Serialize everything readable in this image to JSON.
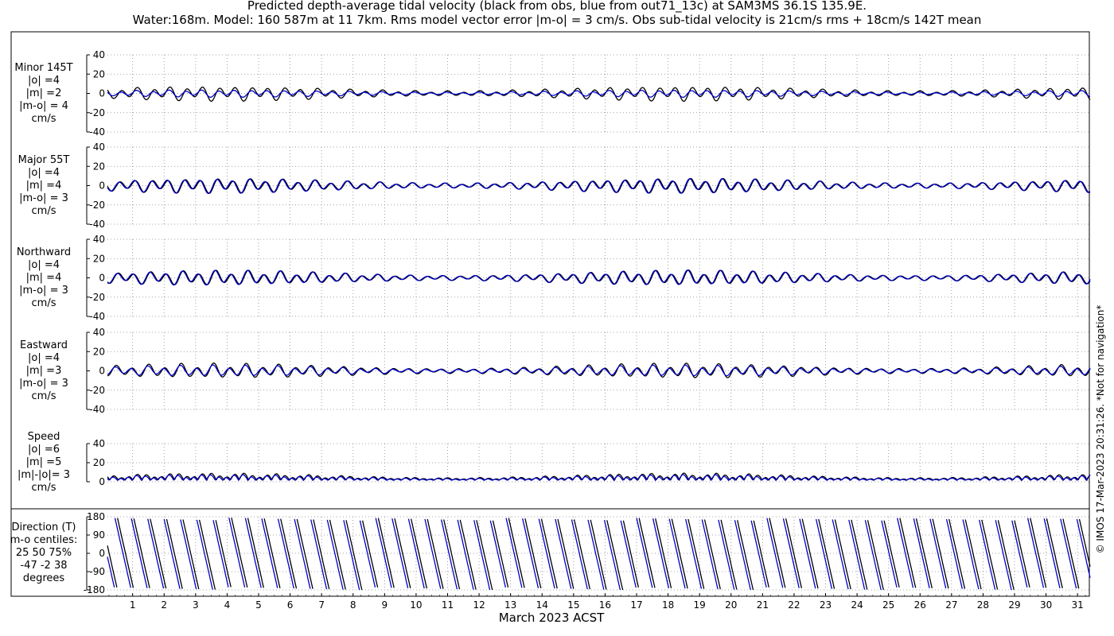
{
  "chart_data": {
    "type": "line",
    "title": "Predicted depth-average tidal velocity (black from obs, blue from out71_13c) at SAM3MS 36.1S 135.9E.",
    "subtitle": "Water:168m. Model: 160 587m at 11 7km. Rms model vector error |m-o| = 3 cm/s. Obs sub-tidal velocity is 21cm/s rms + 18cm/s 142T mean",
    "xlabel": "March 2023 ACST",
    "x_ticks": [
      "1",
      "2",
      "3",
      "4",
      "5",
      "6",
      "7",
      "8",
      "9",
      "10",
      "11",
      "12",
      "13",
      "14",
      "15",
      "16",
      "17",
      "18",
      "19",
      "20",
      "21",
      "22",
      "23",
      "24",
      "25",
      "26",
      "27",
      "28",
      "29",
      "30",
      "31"
    ],
    "xlim": [
      0.2,
      31.4
    ],
    "grid": true,
    "side_note": "© IMOS 17-Mar-2023 20:31:26. *Not for navigation*",
    "series_colors": {
      "obs": "#000000",
      "model": "#0000cc"
    },
    "panels": [
      {
        "id": "minor",
        "label": [
          "Minor 145T",
          "|o| =4",
          "|m| =2",
          "|m-o| = 4",
          "cm/s"
        ],
        "ylim": [
          -40,
          40
        ],
        "yticks": [
          "40",
          "20",
          "0",
          "-20",
          "-40"
        ],
        "amp_obs": 4,
        "amp_model": 2,
        "offset": 0
      },
      {
        "id": "major",
        "label": [
          "Major 55T",
          "|o| =4",
          "|m| =4",
          "|m-o| = 3",
          "cm/s"
        ],
        "ylim": [
          -40,
          40
        ],
        "yticks": [
          "40",
          "20",
          "0",
          "-20",
          "-40"
        ],
        "amp_obs": 4,
        "amp_model": 4,
        "offset": 0
      },
      {
        "id": "north",
        "label": [
          "Northward",
          "|o| =4",
          "|m| =4",
          "|m-o| = 3",
          "cm/s"
        ],
        "ylim": [
          -40,
          40
        ],
        "yticks": [
          "40",
          "20",
          "0",
          "-20",
          "-40"
        ],
        "amp_obs": 4,
        "amp_model": 4,
        "offset": 0
      },
      {
        "id": "east",
        "label": [
          "Eastward",
          "|o| =4",
          "|m| =3",
          "|m-o| = 3",
          "cm/s"
        ],
        "ylim": [
          -40,
          40
        ],
        "yticks": [
          "40",
          "20",
          "0",
          "-20",
          "-40"
        ],
        "amp_obs": 4,
        "amp_model": 3,
        "offset": 0
      },
      {
        "id": "speed",
        "label": [
          "Speed",
          "|o| =6",
          "|m| =5",
          "|m|-|o|= 3",
          "cm/s"
        ],
        "ylim": [
          0,
          40
        ],
        "yticks": [
          "40",
          "20",
          "0"
        ],
        "amp_obs": 6,
        "amp_model": 5,
        "offset": 0
      },
      {
        "id": "direction",
        "label": [
          "Direction (T)",
          "m-o centiles:",
          "25  50  75%",
          "-47  -2  38",
          "degrees"
        ],
        "ylim": [
          -180,
          180
        ],
        "yticks": [
          "180",
          "90",
          "0",
          "-90",
          "-180"
        ]
      }
    ]
  }
}
